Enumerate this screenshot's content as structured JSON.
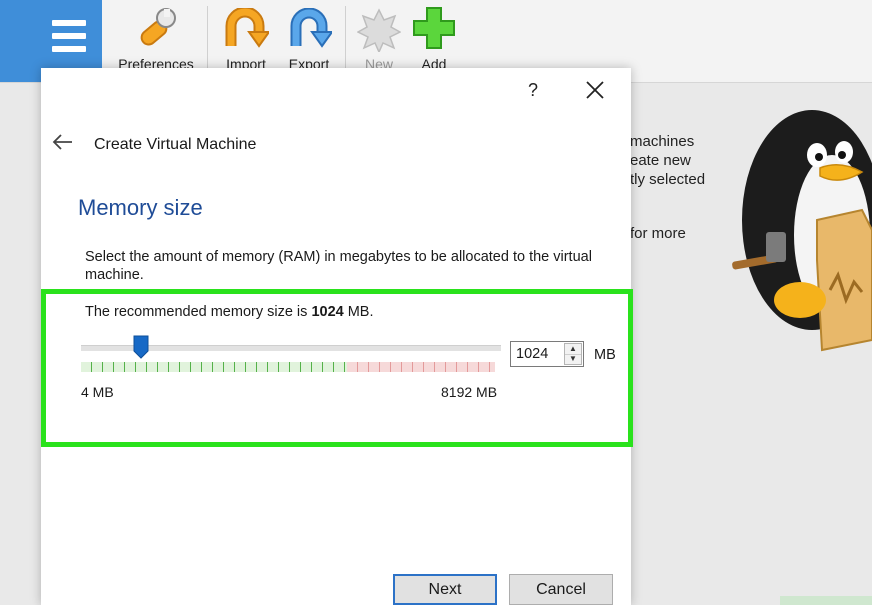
{
  "toolbar": {
    "items": [
      {
        "label": "Preferences",
        "icon": "preferences-icon"
      },
      {
        "label": "Import",
        "icon": "import-icon"
      },
      {
        "label": "Export",
        "icon": "export-icon"
      },
      {
        "label": "New",
        "icon": "new-icon",
        "disabled": true
      },
      {
        "label": "Add",
        "icon": "add-icon"
      }
    ]
  },
  "background": {
    "welcome_lines": "machines\neate new\ntly selected",
    "more_text": "for more"
  },
  "dialog": {
    "help_label": "?",
    "title": "Create Virtual Machine",
    "section_title": "Memory size",
    "description": "Select the amount of memory (RAM) in megabytes to be allocated to the virtual machine.",
    "recommended_prefix": "The recommended memory size is ",
    "recommended_value": "1024",
    "recommended_suffix": " MB.",
    "slider": {
      "min_label": "4 MB",
      "max_label": "8192 MB",
      "min": 4,
      "max": 8192,
      "value": 1024
    },
    "spin_value": "1024",
    "unit": "MB",
    "next_label": "Next",
    "cancel_label": "Cancel"
  },
  "colors": {
    "accent": "#3f8ed9",
    "highlight": "#2ae21c",
    "title_blue": "#1f4c97"
  }
}
